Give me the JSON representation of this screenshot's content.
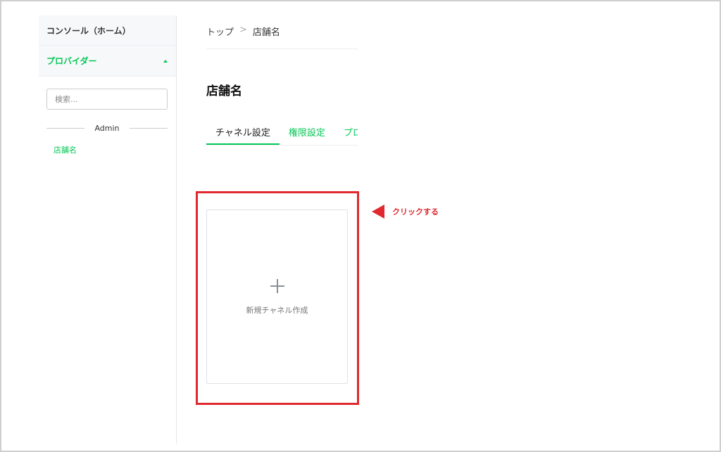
{
  "sidebar": {
    "home_label": "コンソール（ホーム）",
    "provider_label": "プロバイダー",
    "search_placeholder": "検索...",
    "section_label": "Admin",
    "items": [
      {
        "label": "店舗名"
      }
    ]
  },
  "breadcrumb": {
    "root": "トップ",
    "separator": ">",
    "current": "店舗名"
  },
  "page": {
    "title": "店舗名"
  },
  "tabs": [
    {
      "label": "チャネル設定",
      "active": true
    },
    {
      "label": "権限設定",
      "active": false
    },
    {
      "label": "プロバイダー設定",
      "active": false
    }
  ],
  "new_channel_card": {
    "icon": "plus-icon",
    "label": "新規チャネル作成"
  },
  "annotation": {
    "text": "クリックする",
    "color": "#e0282e"
  },
  "colors": {
    "accent": "#06c755",
    "highlight": "#e0282e"
  }
}
